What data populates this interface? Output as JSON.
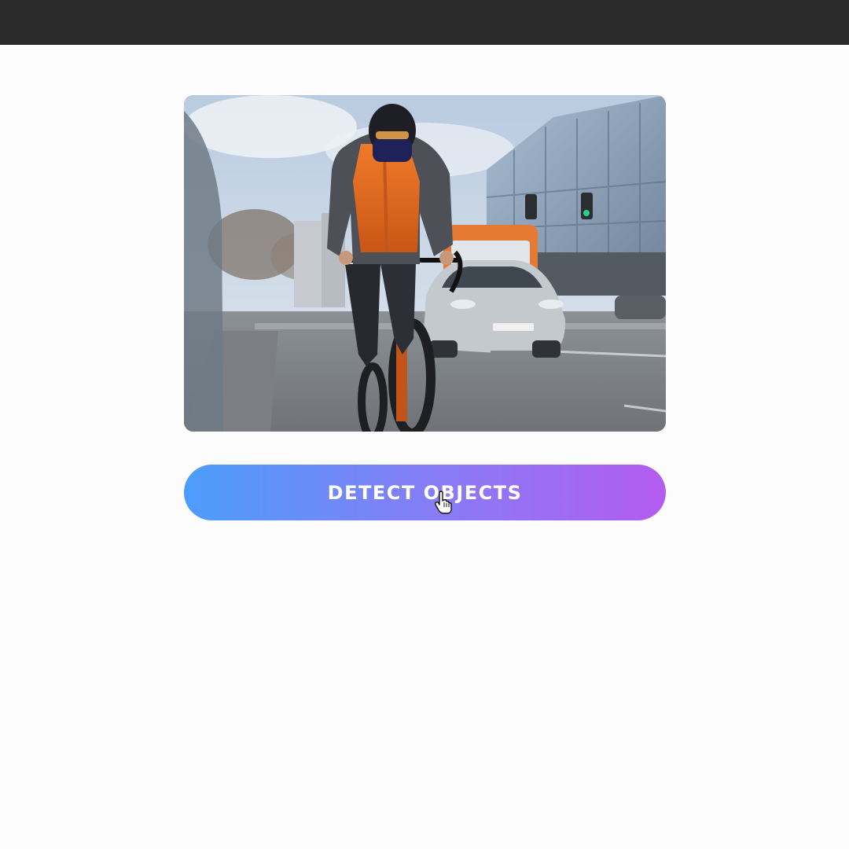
{
  "app": {
    "topbar": {}
  },
  "image": {
    "alt": "cyclist-photo"
  },
  "actions": {
    "detect_label": "DETECT OBJECTS"
  },
  "icons": {
    "cursor": "hand-pointer-icon"
  }
}
